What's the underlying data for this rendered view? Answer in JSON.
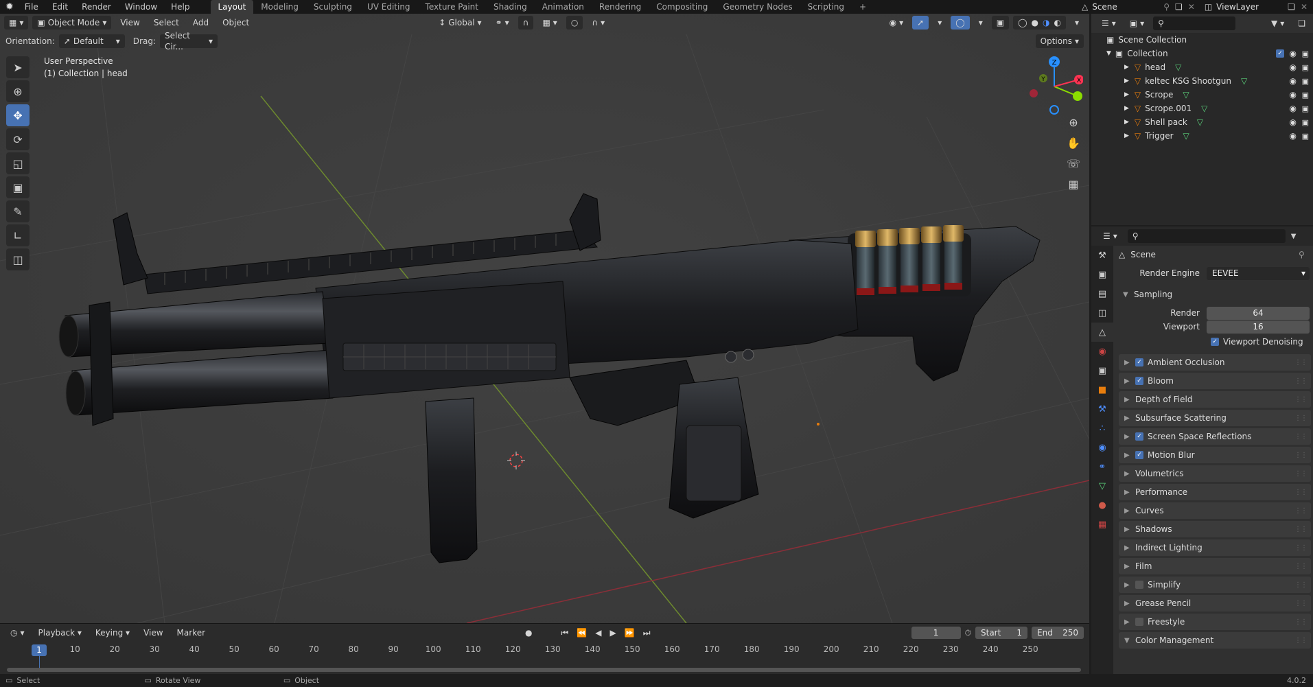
{
  "topbar": {
    "menus": [
      "File",
      "Edit",
      "Render",
      "Window",
      "Help"
    ],
    "workspaces": [
      "Layout",
      "Modeling",
      "Sculpting",
      "UV Editing",
      "Texture Paint",
      "Shading",
      "Animation",
      "Rendering",
      "Compositing",
      "Geometry Nodes",
      "Scripting"
    ],
    "active_workspace": "Layout",
    "add_tab": "+",
    "scene": "Scene",
    "view_layer": "ViewLayer"
  },
  "viewport": {
    "mode": "Object Mode",
    "menus": [
      "View",
      "Select",
      "Add",
      "Object"
    ],
    "transform_orientation": "Global",
    "orientation_label": "Orientation:",
    "orientation_value": "Default",
    "drag_label": "Drag:",
    "drag_value": "Select Cir...",
    "options": "Options",
    "perspective": "User Perspective",
    "context": "(1) Collection | head",
    "gizmo": {
      "x": "X",
      "y": "Y",
      "z": "Z"
    }
  },
  "timeline": {
    "menus": [
      "Playback",
      "Keying",
      "View",
      "Marker"
    ],
    "current_frame": "1",
    "start_label": "Start",
    "start": "1",
    "end_label": "End",
    "end": "250",
    "ticks": [
      "10",
      "20",
      "30",
      "40",
      "50",
      "60",
      "70",
      "80",
      "90",
      "100",
      "110",
      "120",
      "130",
      "140",
      "150",
      "160",
      "170",
      "180",
      "190",
      "200",
      "210",
      "220",
      "230",
      "240",
      "250"
    ],
    "cursor": "1"
  },
  "statusbar": {
    "items": [
      "Select",
      "Rotate View",
      "Object"
    ],
    "version": "4.0.2"
  },
  "outliner": {
    "root": "Scene Collection",
    "collection": "Collection",
    "objects": [
      "head",
      "keltec KSG Shootgun",
      "Scrope",
      "Scrope.001",
      "Shell pack",
      "Trigger"
    ]
  },
  "properties": {
    "context": "Scene",
    "render_engine_label": "Render Engine",
    "render_engine": "EEVEE",
    "sampling": {
      "title": "Sampling",
      "render_label": "Render",
      "render": "64",
      "viewport_label": "Viewport",
      "viewport": "16",
      "denoise": "Viewport Denoising"
    },
    "panels": [
      {
        "label": "Ambient Occlusion",
        "checkbox": true,
        "checked": true
      },
      {
        "label": "Bloom",
        "checkbox": true,
        "checked": true
      },
      {
        "label": "Depth of Field",
        "checkbox": false
      },
      {
        "label": "Subsurface Scattering",
        "checkbox": false
      },
      {
        "label": "Screen Space Reflections",
        "checkbox": true,
        "checked": true
      },
      {
        "label": "Motion Blur",
        "checkbox": true,
        "checked": true
      },
      {
        "label": "Volumetrics",
        "checkbox": false
      },
      {
        "label": "Performance",
        "checkbox": false
      },
      {
        "label": "Curves",
        "checkbox": false
      },
      {
        "label": "Shadows",
        "checkbox": false
      },
      {
        "label": "Indirect Lighting",
        "checkbox": false
      },
      {
        "label": "Film",
        "checkbox": false
      },
      {
        "label": "Simplify",
        "checkbox": true,
        "checked": false
      },
      {
        "label": "Grease Pencil",
        "checkbox": false
      },
      {
        "label": "Freestyle",
        "checkbox": true,
        "checked": false
      },
      {
        "label": "Color Management",
        "checkbox": false,
        "expanded": true
      }
    ]
  },
  "colors": {
    "accent": "#4772b3",
    "axis_x": "#ff3352",
    "axis_y": "#8bdc00",
    "axis_z": "#2890ff",
    "object_orange": "#e87d0d"
  }
}
